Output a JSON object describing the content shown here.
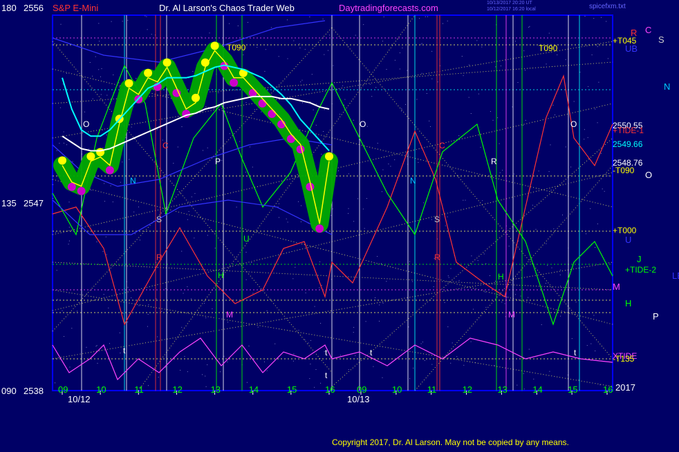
{
  "header": {
    "left_level": "180",
    "left_price": "2556",
    "instrument": "S&P E-Mini",
    "title": "Dr. Al Larson's Chaos Trader Web",
    "site": "Daytradingforecasts.com",
    "stamp_line1": "10/13/2017 20:20 UT",
    "stamp_line2": "10/12/2017 16:20 local",
    "code": "spicefxm.txt"
  },
  "left_axis": [
    {
      "level": "180",
      "price": "2556"
    },
    {
      "level": "135",
      "price": "2547"
    },
    {
      "level": "090",
      "price": "2538"
    }
  ],
  "right_labels": [
    {
      "text": "+T045",
      "color": "#ffff00"
    },
    {
      "text": "T090",
      "color": "#ffff00"
    },
    {
      "text": "2550.55",
      "color": "#ffffff"
    },
    {
      "text": "2549.66",
      "color": "#00ffff"
    },
    {
      "text": "2548.76",
      "color": "#ffffff"
    },
    {
      "text": "-T090",
      "color": "#ffff00"
    },
    {
      "text": "+T000",
      "color": "#ffff00"
    },
    {
      "text": "+TIDE-1",
      "color": "#ff3333"
    },
    {
      "text": "+TIDE-2",
      "color": "#00ff00"
    },
    {
      "text": "XTIDE",
      "color": "#ff44ff"
    },
    {
      "text": "-T135",
      "color": "#ffff00"
    },
    {
      "text": "2017",
      "color": "#ffffff"
    }
  ],
  "planet_labels": [
    {
      "text": "R",
      "color": "#ff3333"
    },
    {
      "text": "C",
      "color": "#ff44ff"
    },
    {
      "text": "S",
      "color": "#cccccc"
    },
    {
      "text": "UB",
      "color": "#3333ff"
    },
    {
      "text": "N",
      "color": "#00ccff"
    },
    {
      "text": "O",
      "color": "#ffffff"
    },
    {
      "text": "U",
      "color": "#3333ff"
    },
    {
      "text": "J",
      "color": "#00ff00"
    },
    {
      "text": "M",
      "color": "#ff44ff"
    },
    {
      "text": "H",
      "color": "#00ff00"
    },
    {
      "text": "P",
      "color": "#ffffff"
    },
    {
      "text": "LB",
      "color": "#3333ff"
    }
  ],
  "in_chart_markers": [
    {
      "text": "T090",
      "color": "#ffff00"
    },
    {
      "text": "T090",
      "color": "#ffff00"
    },
    {
      "text": "O",
      "color": "#ffffff"
    },
    {
      "text": "O",
      "color": "#ffffff"
    },
    {
      "text": "O",
      "color": "#ffffff"
    },
    {
      "text": "N",
      "color": "#00ccff"
    },
    {
      "text": "N",
      "color": "#00ccff"
    },
    {
      "text": "P",
      "color": "#ffffff"
    },
    {
      "text": "R",
      "color": "#ffffff"
    },
    {
      "text": "S",
      "color": "#cccccc"
    },
    {
      "text": "S",
      "color": "#cccccc"
    },
    {
      "text": "R",
      "color": "#ff3333"
    },
    {
      "text": "R",
      "color": "#ff3333"
    },
    {
      "text": "U",
      "color": "#00ff00"
    },
    {
      "text": "H",
      "color": "#00ff00"
    },
    {
      "text": "H",
      "color": "#00ff00"
    },
    {
      "text": "M",
      "color": "#ff44ff"
    },
    {
      "text": "M",
      "color": "#ff44ff"
    },
    {
      "text": "C",
      "color": "#ff3333"
    },
    {
      "text": "C",
      "color": "#ff3333"
    },
    {
      "text": "t",
      "color": "#ffffff"
    },
    {
      "text": "t",
      "color": "#ffffff"
    },
    {
      "text": "t",
      "color": "#ffffff"
    },
    {
      "text": "t",
      "color": "#ffffff"
    },
    {
      "text": "t",
      "color": "#ffffff"
    }
  ],
  "footer": {
    "copyright": "Copyright 2017, Dr. Al Larson. May not be copied by any means."
  },
  "colors": {
    "background": "#000066",
    "frame": "#0000ff",
    "price_cloud": "#00aa00",
    "bull_dots": "#ffff00",
    "bear_dots": "#cc00cc",
    "tide1": "#ff3333",
    "tide2": "#00ff00",
    "xtide": "#ff44ff",
    "ma_fast": "#00ffff",
    "ma_slow": "#ffffff",
    "grid_lines": "#ffff66"
  },
  "chart_data": {
    "type": "line",
    "title": "S&P E-Mini",
    "ylabel": "",
    "ylim": [
      2538,
      2556
    ],
    "left_ticks": [
      {
        "level": "180",
        "price": 2556
      },
      {
        "level": "135",
        "price": 2547
      },
      {
        "level": "090",
        "price": 2538
      }
    ],
    "dates": [
      "10/12",
      "10/13"
    ],
    "x_ticks": [
      "09",
      "10",
      "11",
      "12",
      "13",
      "14",
      "15",
      "16",
      "09",
      "10",
      "11",
      "12",
      "13",
      "14",
      "15",
      "16"
    ],
    "hours": [
      9,
      10,
      11,
      12,
      13,
      14,
      15,
      16
    ],
    "price_x": [
      9.0,
      9.25,
      9.5,
      9.75,
      10.0,
      10.25,
      10.5,
      10.75,
      11.0,
      11.25,
      11.5,
      11.75,
      12.0,
      12.25,
      12.5,
      12.75,
      13.0,
      13.25,
      13.5,
      13.75,
      14.0,
      14.25,
      14.5,
      14.75,
      15.0,
      15.25,
      15.5,
      15.75,
      16.0
    ],
    "price": [
      2548.8,
      2548.0,
      2547.8,
      2549.0,
      2549.2,
      2548.8,
      2550.8,
      2552.5,
      2552.2,
      2553.0,
      2552.8,
      2553.5,
      2552.5,
      2551.5,
      2551.8,
      2553.5,
      2554.3,
      2553.8,
      2553.0,
      2553.0,
      2552.5,
      2552.0,
      2551.5,
      2551.0,
      2550.3,
      2549.8,
      2548.0,
      2546.0,
      2549.0
    ],
    "ma_fast": [
      2553.0,
      2551.5,
      2550.5,
      2550.2,
      2550.2,
      2550.5,
      2551.0,
      2551.5,
      2552.0,
      2552.5,
      2552.7,
      2553.0,
      2553.0,
      2553.0,
      2553.1,
      2553.3,
      2553.5,
      2553.6,
      2553.5,
      2553.4,
      2553.2,
      2553.0,
      2552.6,
      2552.2,
      2551.7,
      2551.0,
      2550.5,
      2550.0,
      2549.5
    ],
    "ma_slow": [
      2550.2,
      2549.9,
      2549.6,
      2549.5,
      2549.5,
      2549.6,
      2549.8,
      2550.0,
      2550.2,
      2550.4,
      2550.6,
      2550.8,
      2551.0,
      2551.2,
      2551.3,
      2551.5,
      2551.6,
      2551.8,
      2551.9,
      2552.0,
      2552.1,
      2552.1,
      2552.1,
      2552.0,
      2552.0,
      2551.9,
      2551.8,
      2551.6,
      2551.5
    ],
    "right_prices": [
      {
        "label": "2550.55",
        "value": 2550.55
      },
      {
        "label": "2549.66",
        "value": 2549.66
      },
      {
        "label": "2548.76",
        "value": 2548.76
      }
    ]
  }
}
